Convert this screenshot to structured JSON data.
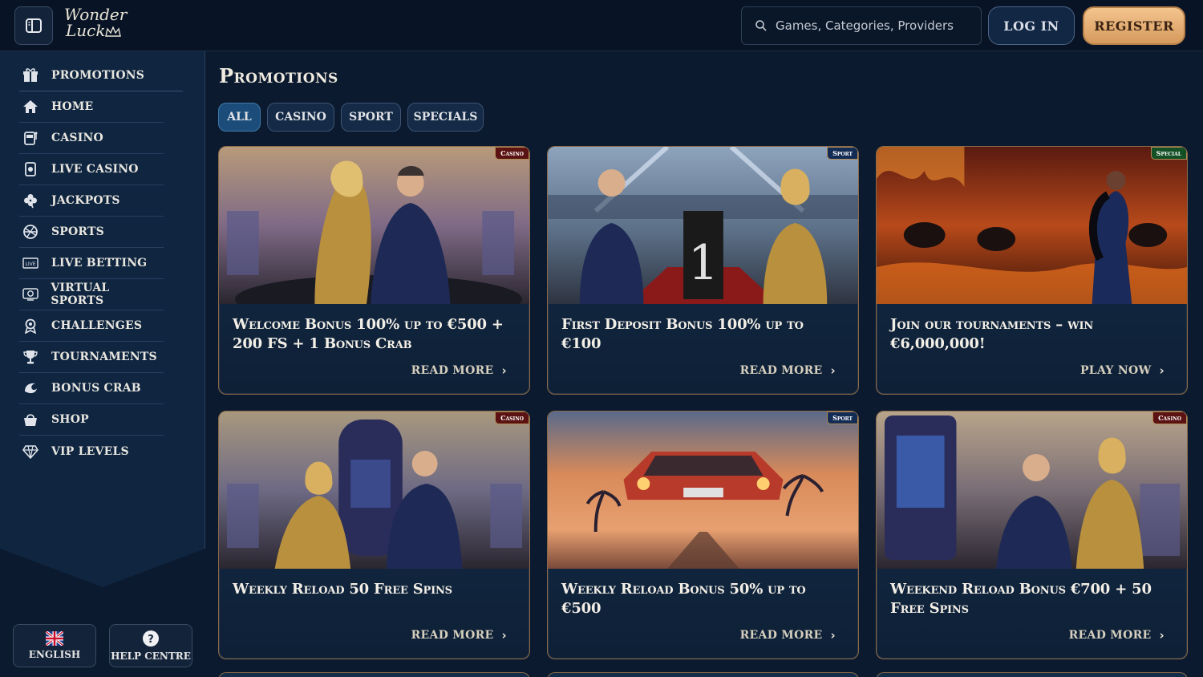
{
  "header": {
    "logo_line1": "Wonder",
    "logo_line2": "Luck",
    "search_placeholder": "Games, Categories, Providers",
    "login_label": "LOG IN",
    "register_label": "REGISTER"
  },
  "sidebar": {
    "items": [
      {
        "label": "PROMOTIONS",
        "icon": "gift-icon"
      },
      {
        "label": "HOME",
        "icon": "home-icon"
      },
      {
        "label": "CASINO",
        "icon": "slot-machine-icon"
      },
      {
        "label": "LIVE CASINO",
        "icon": "live-card-icon"
      },
      {
        "label": "JACKPOTS",
        "icon": "clover-icon"
      },
      {
        "label": "SPORTS",
        "icon": "ball-icon"
      },
      {
        "label": "LIVE BETTING",
        "icon": "live-tag-icon"
      },
      {
        "label": "VIRTUAL SPORTS",
        "icon": "virtual-sports-icon"
      },
      {
        "label": "CHALLENGES",
        "icon": "medal-icon"
      },
      {
        "label": "TOURNAMENTS",
        "icon": "trophy-icon"
      },
      {
        "label": "BONUS CRAB",
        "icon": "crab-icon"
      },
      {
        "label": "SHOP",
        "icon": "shop-bag-icon"
      },
      {
        "label": "VIP LEVELS",
        "icon": "diamond-icon"
      }
    ],
    "language_label": "ENGLISH",
    "help_label": "HELP CENTRE"
  },
  "main": {
    "title": "Promotions",
    "filters": [
      "ALL",
      "CASINO",
      "SPORT",
      "SPECIALS"
    ],
    "active_filter": "ALL",
    "cards": [
      {
        "badge": "Casino",
        "title": "Welcome Bonus 100% up to €500 + 200 FS + 1 Bonus Crab",
        "link": "READ MORE"
      },
      {
        "badge": "Sport",
        "title": "First Deposit Bonus 100% up to €100",
        "link": "READ MORE"
      },
      {
        "badge": "Special",
        "title": "Join our tournaments – win €6,000,000!",
        "link": "PLAY NOW"
      },
      {
        "badge": "Casino",
        "title": "Weekly Reload 50 Free Spins",
        "link": "READ MORE"
      },
      {
        "badge": "Sport",
        "title": "Weekly Reload Bonus 50% up to €500",
        "link": "READ MORE"
      },
      {
        "badge": "Casino",
        "title": "Weekend Reload Bonus €700 + 50 Free Spins",
        "link": "READ MORE"
      }
    ]
  },
  "colors": {
    "background": "#0b1a2e",
    "sidebar": "#0f2540",
    "accent_gold": "#d69a5c",
    "active_filter": "#1c4d7a"
  }
}
